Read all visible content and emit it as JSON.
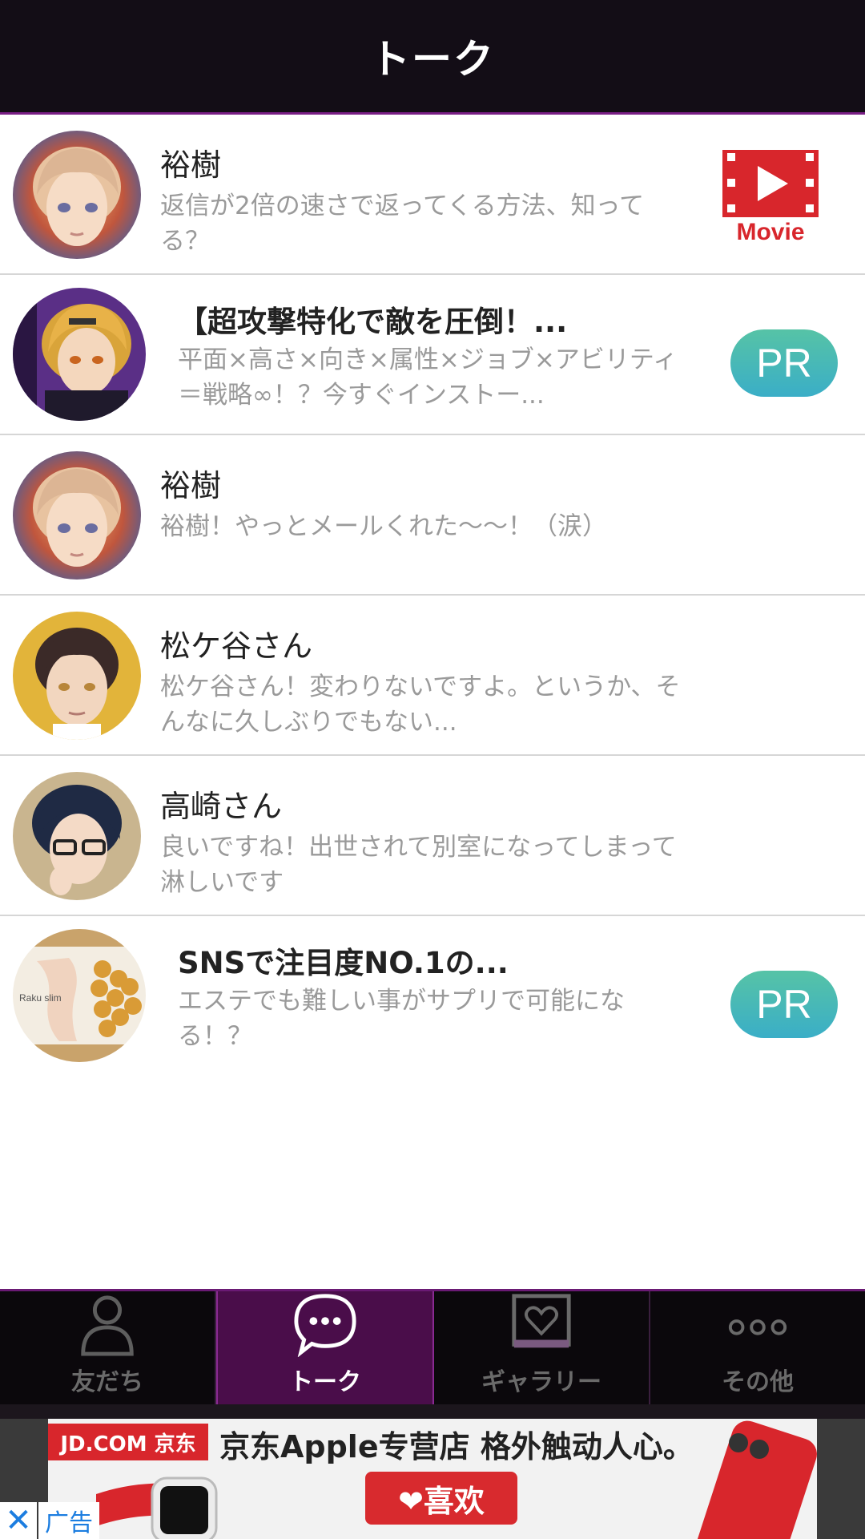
{
  "header": {
    "title": "トーク"
  },
  "talks": [
    {
      "name": "裕樹",
      "preview": "返信が2倍の速さで返ってくる方法、知ってる？",
      "badge": "Movie"
    },
    {
      "name": "【超攻撃特化で敵を圧倒！...",
      "preview": "平面×高さ×向き×属性×ジョブ×アビリティ＝戦略∞！？今すぐインストー...",
      "badge": "PR"
    },
    {
      "name": "裕樹",
      "preview": "裕樹！やっとメールくれた〜〜！（涙）"
    },
    {
      "name": "松ケ谷さん",
      "preview": "松ケ谷さん！変わりないですよ。というか、そんなに久しぶりでもない..."
    },
    {
      "name": "高崎さん",
      "preview": "良いですね！出世されて別室になってしまって淋しいです"
    },
    {
      "name": "SNSで注目度NO.1の...",
      "preview": "エステでも難しい事がサプリで可能になる！？",
      "badge": "PR",
      "avatar_text": "Raku slim"
    }
  ],
  "nav": {
    "tabs": [
      {
        "label": "友だち",
        "icon": "person-icon"
      },
      {
        "label": "トーク",
        "icon": "chat-bubble-icon",
        "active": true
      },
      {
        "label": "ギャラリー",
        "icon": "heart-gallery-icon"
      },
      {
        "label": "その他",
        "icon": "more-dots-icon"
      }
    ]
  },
  "ad": {
    "brand": "JD.COM 京东",
    "headline": "京东Apple专营店  格外触动人心。",
    "like_label": "❤喜欢",
    "close": "✕",
    "tag": "广告"
  },
  "colors": {
    "header_bg": "#130d16",
    "accent_purple": "#4a0d4a",
    "pr_badge": "#3aaec7",
    "movie_red": "#d8262c"
  }
}
